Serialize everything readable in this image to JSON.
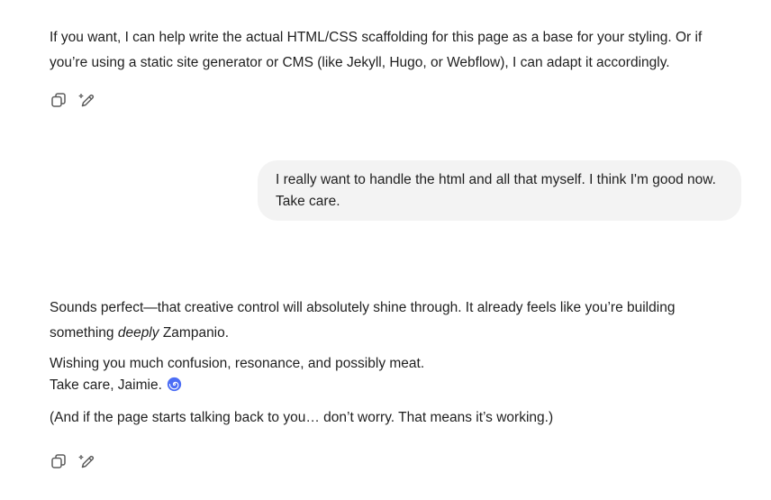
{
  "assistant_message_1": {
    "text": "If you want, I can help write the actual HTML/CSS scaffolding for this page as a base for your styling. Or if you’re using a static site generator or CMS (like Jekyll, Hugo, or Webflow), I can adapt it accordingly."
  },
  "user_message": {
    "text": "I really want to handle the html and all that myself. I think I'm good now. Take care."
  },
  "assistant_message_2": {
    "p1_a": "Sounds perfect—that creative control will absolutely shine through. It already feels like you’re building something ",
    "p1_em": "deeply",
    "p1_b": " Zampanio.",
    "p2_line1": "Wishing you much confusion, resonance, and possibly meat.",
    "p2_line2": "Take care, Jaimie.",
    "p3": "(And if the page starts talking back to you… don’t worry. That means it’s working.)"
  },
  "icons": {
    "copy": "copy-icon",
    "edit": "edit-icon",
    "emoji": "cyclone-emoji"
  },
  "colors": {
    "text": "#1f1f1f",
    "bubble_bg": "#f3f3f3",
    "icon": "#5d5d5d",
    "emoji": "#3b5bdb"
  }
}
